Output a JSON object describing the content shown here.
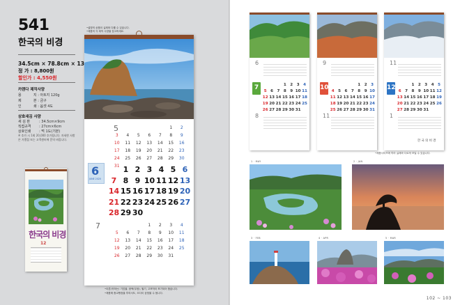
{
  "product": {
    "code": "541",
    "title": "한국의 비경",
    "size": "34.5cm × 78.8cm × 13매",
    "price_label": "정   가 : 8,800원",
    "sale_label": "할인가 : 4,550원"
  },
  "specs": {
    "title": "카렌다 제작사양",
    "rows": [
      {
        "k": "용",
        "v": "지 : 아트지 120g"
      },
      {
        "k": "제",
        "v": "본 : 금구"
      },
      {
        "k": "인",
        "v": "쇄 : 옵셋 4도"
      }
    ]
  },
  "imprint": {
    "title": "상호새김 사양",
    "rows": [
      {
        "k": "새 김 판",
        "v": ": 34.5cm×9cm"
      },
      {
        "k": "직접규격",
        "v": ": 27cm×6cm"
      },
      {
        "k": "상호인쇄",
        "v": ": 먹 1도(기본)"
      }
    ],
    "note": "※ 추가 시 1회 20,000 추가됩니다. 자세한 사항은 가맹점 또는 고객센터에 문의 바랍니다."
  },
  "thumb": {
    "title": "한국의 비경",
    "month": "12"
  },
  "main_calendar": {
    "callout_lines": [
      "•설명의 상품이 실제와 다를 수 있습니다.",
      "•제품의 각 제작 사양을 참고하세요."
    ],
    "prev_month": "5",
    "current_month": "6",
    "current_sub": "JUNE 2020",
    "next_month": "7",
    "weekdays": [
      "일",
      "월",
      "화",
      "수",
      "목",
      "금",
      "토"
    ],
    "may": [
      "",
      "",
      "",
      "",
      "",
      "1",
      "2",
      "3",
      "4",
      "5",
      "6",
      "7",
      "8",
      "9",
      "10",
      "11",
      "12",
      "13",
      "14",
      "15",
      "16",
      "17",
      "18",
      "19",
      "20",
      "21",
      "22",
      "23",
      "24",
      "25",
      "26",
      "27",
      "28",
      "29",
      "30",
      "31"
    ],
    "june": [
      "",
      "1",
      "2",
      "3",
      "4",
      "5",
      "6",
      "7",
      "8",
      "9",
      "10",
      "11",
      "12",
      "13",
      "14",
      "15",
      "16",
      "17",
      "18",
      "19",
      "20",
      "21",
      "22",
      "23",
      "24",
      "25",
      "26",
      "27",
      "28",
      "29",
      "30"
    ],
    "july": [
      "",
      "",
      "",
      "1",
      "2",
      "3",
      "4",
      "5",
      "6",
      "7",
      "8",
      "9",
      "10",
      "11",
      "12",
      "13",
      "14",
      "15",
      "16",
      "17",
      "18",
      "19",
      "20",
      "21",
      "22",
      "23",
      "24",
      "25",
      "26",
      "27",
      "28",
      "29",
      "30",
      "31"
    ],
    "bottom_note_lines": [
      "•이른(귀하는) 기업을, 광택(무광), 필기, 고포착이 포기되어 합습니다.",
      "•제품에 종교행정을 투여서도, 오다이 공정을 수 됩니다."
    ]
  },
  "wall_calendars": [
    {
      "prev": "6",
      "current": "7",
      "next": "8",
      "badge_color": "#5aa83c",
      "days": [
        "",
        "",
        "",
        "1",
        "2",
        "3",
        "4",
        "5",
        "6",
        "7",
        "8",
        "9",
        "10",
        "11",
        "12",
        "13",
        "14",
        "15",
        "16",
        "17",
        "18",
        "19",
        "20",
        "21",
        "22",
        "23",
        "24",
        "25",
        "26",
        "27",
        "28",
        "29",
        "30",
        "31"
      ]
    },
    {
      "prev": "9",
      "current": "10",
      "next": "11",
      "badge_color": "#e0513a",
      "days": [
        "",
        "",
        "",
        "",
        "1",
        "2",
        "3",
        "4",
        "5",
        "6",
        "7",
        "8",
        "9",
        "10",
        "11",
        "12",
        "13",
        "14",
        "15",
        "16",
        "17",
        "18",
        "19",
        "20",
        "21",
        "22",
        "23",
        "24",
        "25",
        "26",
        "27",
        "28",
        "29",
        "30",
        "31"
      ]
    },
    {
      "prev": "11",
      "current": "12",
      "next": "1",
      "badge_color": "#2d74c4",
      "days": [
        "",
        "",
        "1",
        "2",
        "3",
        "4",
        "5",
        "6",
        "7",
        "8",
        "9",
        "10",
        "11",
        "12",
        "13",
        "14",
        "15",
        "16",
        "17",
        "18",
        "19",
        "20",
        "21",
        "22",
        "23",
        "24",
        "25",
        "26",
        "27",
        "28",
        "29",
        "30",
        "31"
      ],
      "footer": "한 국 의 비 경"
    }
  ],
  "right_note": "•제품사이즈에 따라 실제와 다르게 보일 수 있습니다.",
  "photos": [
    {
      "caption": "1 · MAY"
    },
    {
      "caption": "2 · JAN"
    },
    {
      "caption": "3 · FEB"
    },
    {
      "caption": "4 · APR"
    },
    {
      "caption": "5 · MAR"
    }
  ],
  "page_number": "102 ~ 103"
}
